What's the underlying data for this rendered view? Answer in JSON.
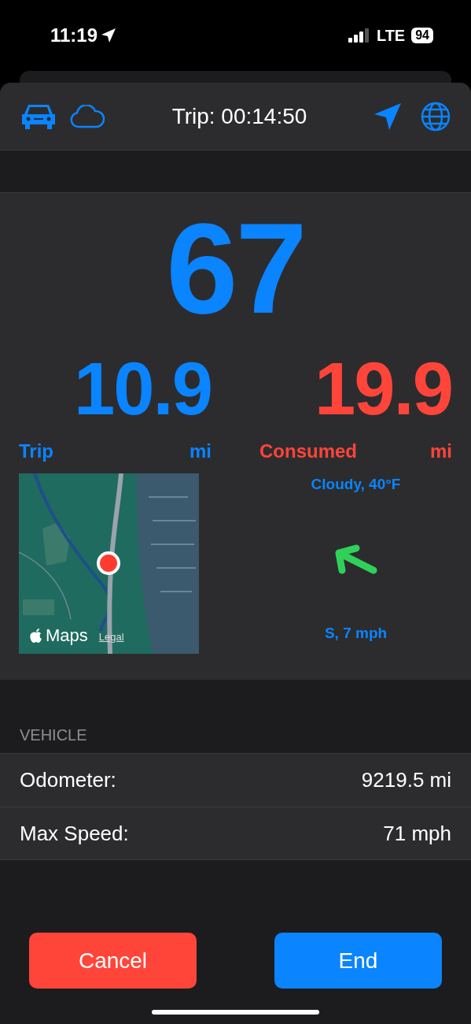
{
  "status_bar": {
    "time": "11:19",
    "network": "LTE",
    "battery": "94"
  },
  "header": {
    "title": "Trip: 00:14:50"
  },
  "speed": "67",
  "stats": [
    {
      "value": "10.9",
      "label": "Trip",
      "unit": "mi",
      "color": "#0a84ff"
    },
    {
      "value": "19.9",
      "label": "Consumed",
      "unit": "mi",
      "color": "#ff453a"
    }
  ],
  "map": {
    "brand": "Maps",
    "legal": "Legal"
  },
  "weather": {
    "condition": "Cloudy, 40°F",
    "wind": "S, 7 mph"
  },
  "vehicle": {
    "header": "VEHICLE",
    "rows": [
      {
        "label": "Odometer:",
        "value": "9219.5 mi"
      },
      {
        "label": "Max Speed:",
        "value": "71 mph"
      }
    ]
  },
  "buttons": [
    {
      "label": "Cancel",
      "kind": "cancel"
    },
    {
      "label": "End",
      "kind": "confirm"
    }
  ]
}
